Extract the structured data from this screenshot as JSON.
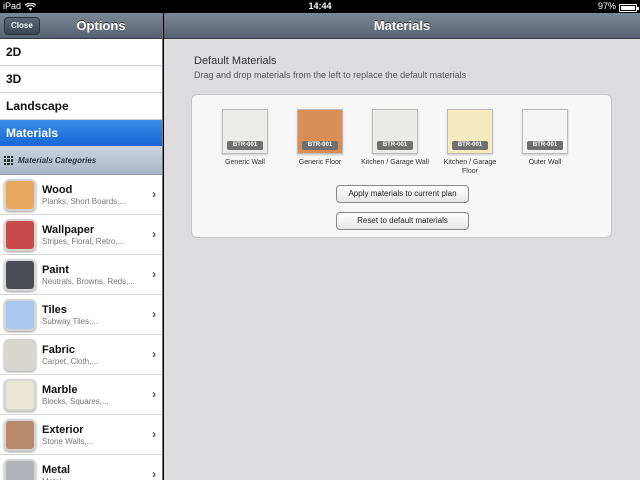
{
  "status": {
    "device": "iPad",
    "time": "14:44",
    "battery": "97%",
    "battery_level": 0.97
  },
  "options": {
    "title": "Options",
    "close_label": "Close",
    "nav": [
      "2D",
      "3D",
      "Landscape",
      "Materials"
    ],
    "selected_nav": "Materials",
    "categories_header": "Materials Categories",
    "categories": [
      {
        "name": "Wood",
        "sub": "Planks, Short Boards,...",
        "color": "#e8a860"
      },
      {
        "name": "Wallpaper",
        "sub": "Stripes, Floral, Retro,...",
        "color": "#c94a4a"
      },
      {
        "name": "Paint",
        "sub": "Neutrals, Browns, Reds,...",
        "color": "#4b4d55"
      },
      {
        "name": "Tiles",
        "sub": "Subway Tiles,...",
        "color": "#a9c8ee"
      },
      {
        "name": "Fabric",
        "sub": "Carpet, Cloth,...",
        "color": "#d8d6cf"
      },
      {
        "name": "Marble",
        "sub": "Blocks, Squares,...",
        "color": "#e9e6d6"
      },
      {
        "name": "Exterior",
        "sub": "Stone Walls,...",
        "color": "#b98b6e"
      },
      {
        "name": "Metal",
        "sub": "Metal,...",
        "color": "#b0b4b8"
      }
    ]
  },
  "materials": {
    "title": "Materials",
    "section_title": "Default Materials",
    "section_sub": "Drag and drop materials from the left to replace the default materials",
    "items": [
      {
        "tag": "BTR-001",
        "label": "Generic Wall",
        "color": "#ececea"
      },
      {
        "tag": "BTR-001",
        "label": "Generic Floor",
        "color": "#d98e55"
      },
      {
        "tag": "BTR-001",
        "label": "Kitchen / Garage Wall",
        "color": "#ebebe8"
      },
      {
        "tag": "BTR-001",
        "label": "Kitchen / Garage Floor",
        "color": "#f5e9c0"
      },
      {
        "tag": "BTR-001",
        "label": "Outer Wall",
        "color": "#f4f4f4"
      }
    ],
    "apply_label": "Apply materials to current plan",
    "reset_label": "Reset to default materials"
  }
}
